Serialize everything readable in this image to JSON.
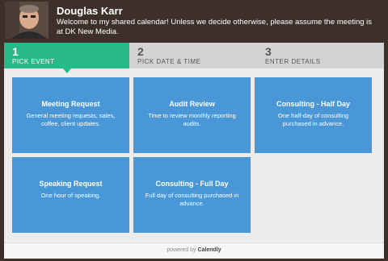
{
  "header": {
    "name": "Douglas Karr",
    "message": "Welcome to my shared calendar! Unless we decide otherwise, please assume the meeting is at DK New Media."
  },
  "steps": [
    {
      "number": "1",
      "label": "PICK EVENT",
      "state": "active"
    },
    {
      "number": "2",
      "label": "PICK DATE & TIME",
      "state": "inactive"
    },
    {
      "number": "3",
      "label": "ENTER DETAILS",
      "state": "inactive"
    }
  ],
  "events": [
    {
      "title": "Meeting Request",
      "description": "General meeting requests, sales, coffee, client updates."
    },
    {
      "title": "Audit Review",
      "description": "Time to review monthly reporting audits."
    },
    {
      "title": "Consulting - Half Day",
      "description": "One half-day of consulting purchased in advance."
    },
    {
      "title": "Speaking Request",
      "description": "One hour of speaking."
    },
    {
      "title": "Consulting - Full Day",
      "description": "Full day of consulting purchased in advance."
    }
  ],
  "footer": {
    "prefix": "powered by",
    "brand": "Calendly"
  },
  "colors": {
    "header_bg": "#3d302b",
    "step_active": "#27ba86",
    "step_inactive": "#d3d3d3",
    "card_bg": "#4a97d8",
    "content_bg": "#ececec"
  }
}
